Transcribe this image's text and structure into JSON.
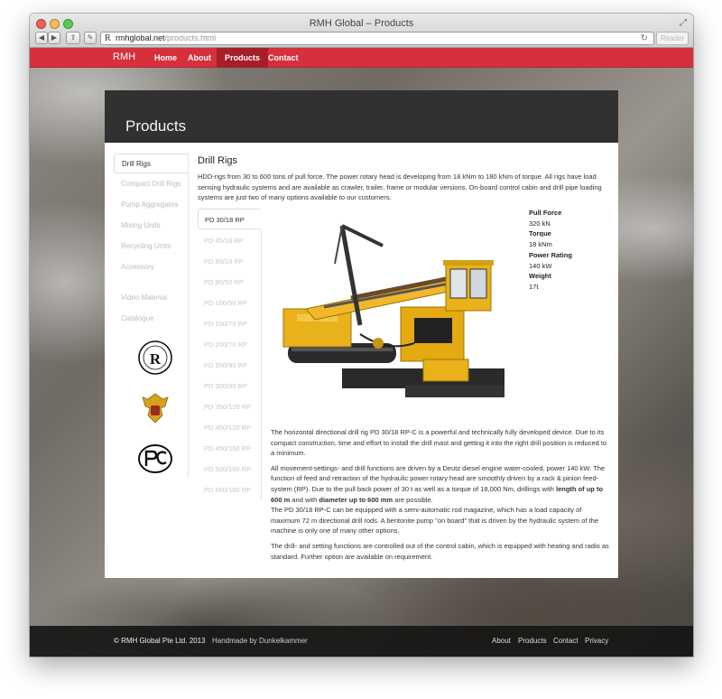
{
  "browser": {
    "title": "RMH Global – Products",
    "url_host": "rmhglobal.net",
    "url_path": "/products.html",
    "reader_label": "Reader"
  },
  "nav": {
    "brand": "RMH",
    "links": [
      "Home",
      "About",
      "Products",
      "Contact"
    ]
  },
  "page": {
    "title": "Products"
  },
  "sidebar": {
    "items": [
      "Drill Rigs",
      "Compact Drill Rigs",
      "Pump Aggregates",
      "Mixing Units",
      "Recycling Units",
      "Accessory",
      "Video Material",
      "Catalogue"
    ],
    "active": "Drill Rigs",
    "certificates": [
      "certification-seal",
      "state-emblem",
      "pc-mark"
    ]
  },
  "content": {
    "title": "Drill Rigs",
    "intro": "HDD-rigs from 30 to 600 tons of pull force. The power rotary head is developing from 18 kNm to 180 kNm of torque. All rigs have load sensing hydraulic systems and are available as crawler, trailer, frame or modular versions. On-board control cabin and drill pipe loading systems are just two of many options available to our customers.",
    "models": [
      "PD 30/18 RP",
      "PD 45/18 RP",
      "PD 60/33 RP",
      "PD 80/50 RP",
      "PD 100/50 RP",
      "PD 150/70 RP",
      "PD 200/70 RP",
      "PD 250/90 RP",
      "PD 300/90 RP",
      "PD 350/120 RP",
      "PD 400/120 RP",
      "PD 450/150 RP",
      "PD 500/180 RP",
      "PD 600/180 RP"
    ],
    "active_model": "PD 30/18 RP",
    "specs": [
      {
        "label": "Pull Force",
        "value": "320 kN"
      },
      {
        "label": "Torque",
        "value": "18 kNm"
      },
      {
        "label": "Power Rating",
        "value": "140 kW"
      },
      {
        "label": "Weight",
        "value": "17t"
      }
    ],
    "desc_p1": "The horizontal directional drill rig PD 30/18 RP-C is a powerful and technically fully developed device. Due to its compact construction, time and effort to install the drill mast and getting it into the right drill position is reduced to a minimum.",
    "desc_p2a": "All movement-settings- and drill functions are driven by a Deutz diesel engine water-cooled, power 140 kW. The function of feed and retraction of the hydraulic power rotary head are smoothly driven by a rack & pinion feed-system (RP). Due to the pull back power of 30 t as well as a torque of 18,000 Nm, drillings with ",
    "desc_p2_b1": "length of up to 600 m",
    "desc_p2_mid": " and with ",
    "desc_p2_b2": "diameter up to 600 mm",
    "desc_p2_end": " are possible.",
    "desc_p2b": "The PD 30/18 RP-C can be equipped with a semi-automatic rod magazine, which has a load capacity of maximum 72 m directional drill rods. A bentonite pump \"on board\" that is driven by the hydraulic system of the machine is only one of many other options.",
    "desc_p3": "The drill- and setting functions are controlled out of the control cabin, which is equipped with heating and radio as standard. Further option are available on requirement."
  },
  "footer": {
    "copyright": "© RMH Global Pte Ltd. 2013",
    "handmade": "Handmade by Dunkelkammer",
    "links": [
      "About",
      "Products",
      "Contact",
      "Privacy"
    ]
  },
  "colors": {
    "brand_red": "#d6303c",
    "active_red": "#a51e28",
    "machine_yellow": "#e9b21a"
  }
}
